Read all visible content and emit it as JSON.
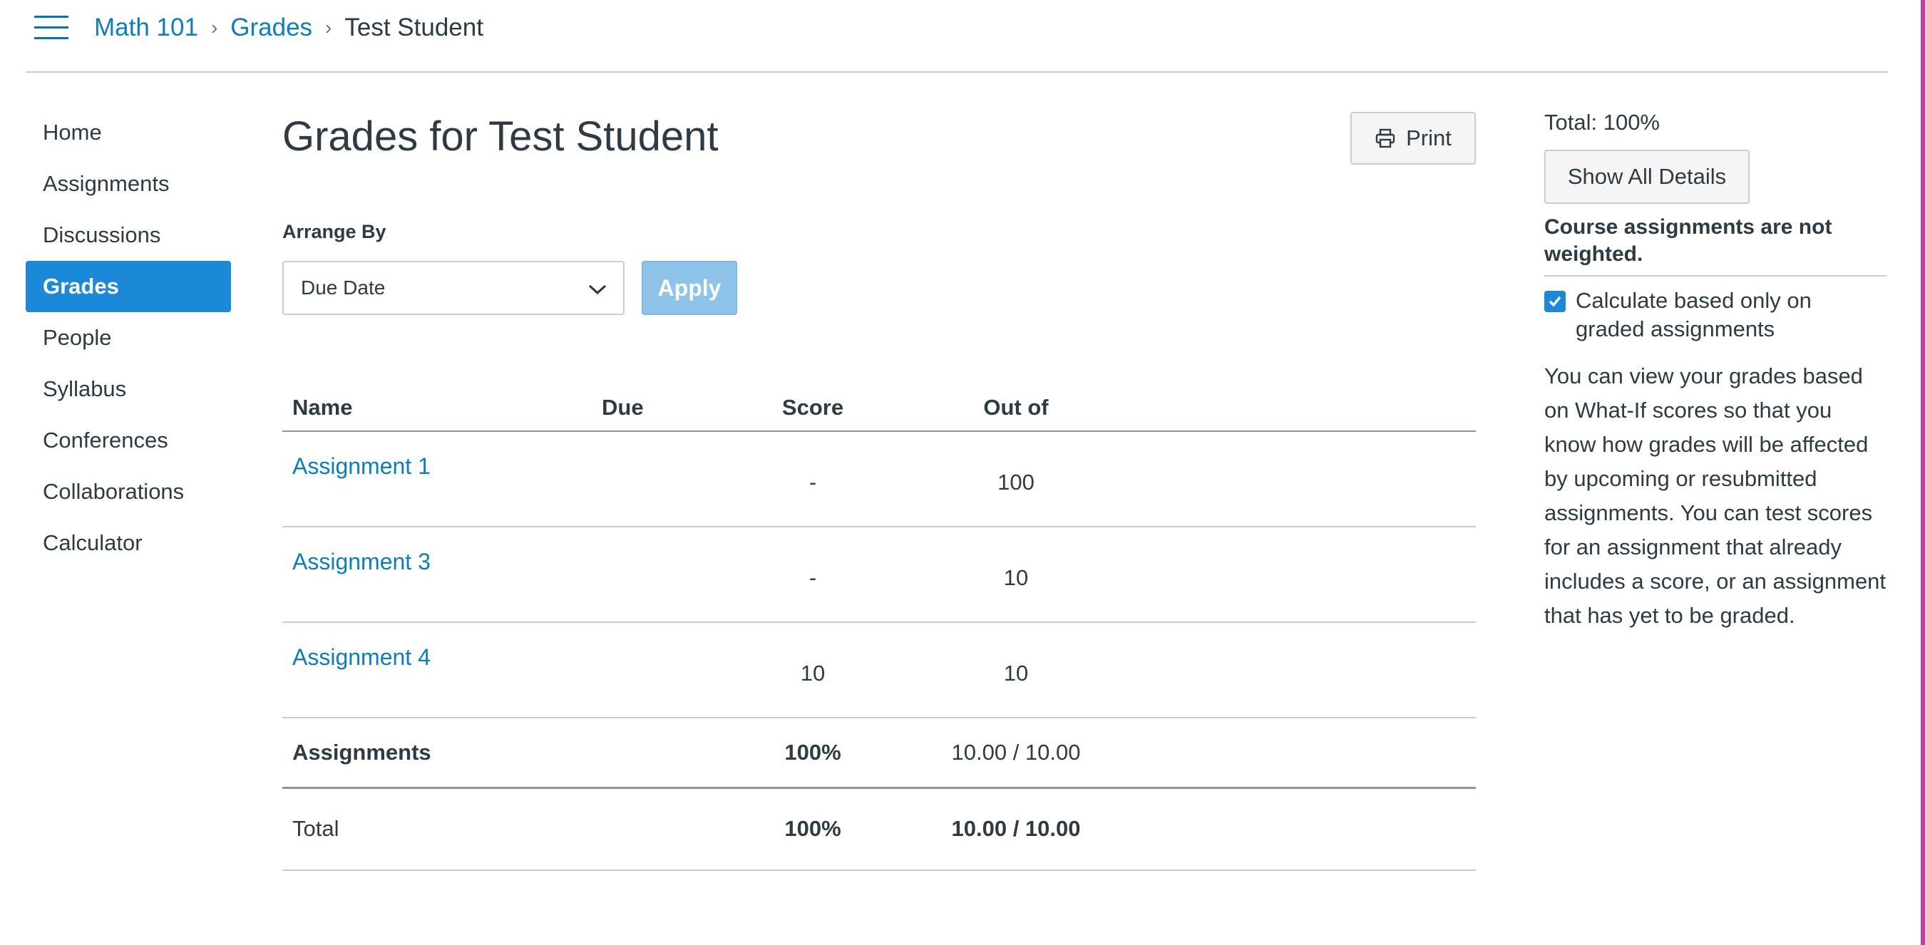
{
  "breadcrumb": {
    "course": "Math 101",
    "section": "Grades",
    "current": "Test Student"
  },
  "nav": {
    "items": [
      {
        "label": "Home"
      },
      {
        "label": "Assignments"
      },
      {
        "label": "Discussions"
      },
      {
        "label": "Grades",
        "active": true
      },
      {
        "label": "People"
      },
      {
        "label": "Syllabus"
      },
      {
        "label": "Conferences"
      },
      {
        "label": "Collaborations"
      },
      {
        "label": "Calculator"
      }
    ]
  },
  "main": {
    "title": "Grades for Test Student",
    "print_label": "Print",
    "arrange_label": "Arrange By",
    "arrange_value": "Due Date",
    "apply_label": "Apply"
  },
  "table": {
    "headers": {
      "name": "Name",
      "due": "Due",
      "score": "Score",
      "out_of": "Out of"
    },
    "rows": [
      {
        "name": "Assignment 1",
        "due": "",
        "score": "-",
        "out_of": "100"
      },
      {
        "name": "Assignment 3",
        "due": "",
        "score": "-",
        "out_of": "10"
      },
      {
        "name": "Assignment 4",
        "due": "",
        "score": "10",
        "out_of": "10"
      }
    ],
    "group": {
      "name": "Assignments",
      "score": "100%",
      "out_of": "10.00 / 10.00"
    },
    "total": {
      "name": "Total",
      "score": "100%",
      "out_of": "10.00 / 10.00"
    }
  },
  "sidebar": {
    "total_text": "Total: 100%",
    "show_details_label": "Show All Details",
    "weight_note": "Course assignments are not weighted.",
    "calc_label": "Calculate based only on graded assignments",
    "calc_checked": true,
    "whatif_text": "You can view your grades based on What-If scores so that you know how grades will be affected by upcoming or resubmitted assignments. You can test scores for an assignment that already includes a score, or an assignment that has yet to be graded."
  },
  "colors": {
    "link": "#0b7dc2",
    "active_nav": "#1b88d8",
    "apply_button": "#8ec3ea",
    "text": "#2d3b45",
    "right_edge": "#b8479c"
  },
  "icons": {
    "menu": "hamburger-icon",
    "print": "printer-icon",
    "dropdown": "chevron-down-icon",
    "breadcrumb_separator": "chevron-right-icon",
    "checkbox": "checkmark-icon"
  }
}
